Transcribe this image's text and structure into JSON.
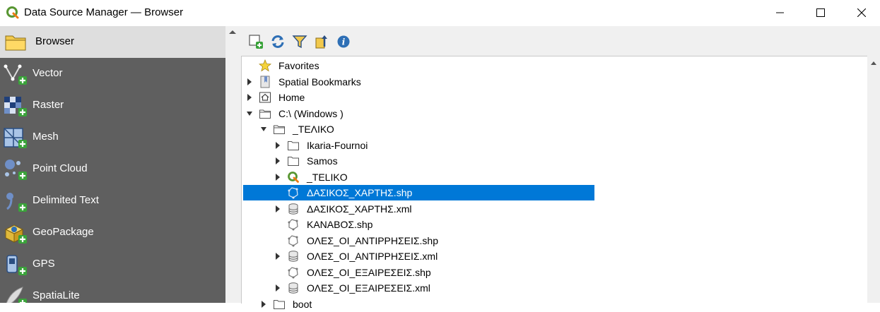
{
  "window": {
    "title": "Data Source Manager — Browser",
    "icon": "qgis-logo-icon",
    "controls": [
      "minimize-icon",
      "maximize-icon",
      "close-icon"
    ]
  },
  "sidebar": {
    "items": [
      {
        "label": "Browser",
        "icon": "folder-icon",
        "active": true
      },
      {
        "label": "Vector",
        "icon": "vector-add-icon"
      },
      {
        "label": "Raster",
        "icon": "raster-add-icon"
      },
      {
        "label": "Mesh",
        "icon": "mesh-add-icon"
      },
      {
        "label": "Point Cloud",
        "icon": "point-cloud-add-icon"
      },
      {
        "label": "Delimited Text",
        "icon": "delimited-text-add-icon"
      },
      {
        "label": "GeoPackage",
        "icon": "geopackage-add-icon"
      },
      {
        "label": "GPS",
        "icon": "gps-add-icon"
      },
      {
        "label": "SpatiaLite",
        "icon": "spatialite-add-icon"
      }
    ]
  },
  "toolbar": {
    "buttons": [
      "add-layer-icon",
      "refresh-icon",
      "filter-icon",
      "collapse-all-icon",
      "info-icon"
    ]
  },
  "tree": {
    "items": [
      {
        "label": "Favorites",
        "icon": "star-icon",
        "expander": "none"
      },
      {
        "label": "Spatial Bookmarks",
        "icon": "bookmark-icon",
        "expander": "collapsed"
      },
      {
        "label": "Home",
        "icon": "home-icon",
        "expander": "collapsed"
      },
      {
        "label": "C:\\ (Windows )",
        "icon": "drive-icon",
        "expander": "expanded"
      },
      {
        "label": "_ΤΕΛΙΚΟ",
        "icon": "folder-open-icon",
        "expander": "expanded"
      },
      {
        "label": "Ikaria-Fournoi",
        "icon": "folder-icon",
        "expander": "collapsed"
      },
      {
        "label": "Samos",
        "icon": "folder-icon",
        "expander": "collapsed"
      },
      {
        "label": "_TELIKO",
        "icon": "qgis-project-icon",
        "expander": "collapsed"
      },
      {
        "label": "ΔΑΣΙΚΟΣ_ΧΑΡΤΗΣ.shp",
        "icon": "polygon-layer-icon",
        "expander": "none",
        "selected": true
      },
      {
        "label": "ΔΑΣΙΚΟΣ_ΧΑΡΤΗΣ.xml",
        "icon": "database-icon",
        "expander": "collapsed"
      },
      {
        "label": "ΚΑΝΑΒΟΣ.shp",
        "icon": "polygon-layer-icon",
        "expander": "none"
      },
      {
        "label": "ΟΛΕΣ_ΟΙ_ΑΝΤΙΡΡΗΣΕΙΣ.shp",
        "icon": "polygon-layer-icon",
        "expander": "none"
      },
      {
        "label": "ΟΛΕΣ_ΟΙ_ΑΝΤΙΡΡΗΣΕΙΣ.xml",
        "icon": "database-icon",
        "expander": "collapsed"
      },
      {
        "label": "ΟΛΕΣ_ΟΙ_ΕΞΑΙΡΕΣΕΙΣ.shp",
        "icon": "polygon-layer-icon",
        "expander": "none"
      },
      {
        "label": "ΟΛΕΣ_ΟΙ_ΕΞΑΙΡΕΣΕΙΣ.xml",
        "icon": "database-icon",
        "expander": "collapsed"
      },
      {
        "label": "boot",
        "icon": "folder-icon",
        "expander": "collapsed"
      }
    ]
  },
  "colors": {
    "sidebar_bg": "#5f5f5f",
    "sidebar_active_bg": "#dedede",
    "selection": "#0078d7",
    "qgis_green": "#589632"
  }
}
